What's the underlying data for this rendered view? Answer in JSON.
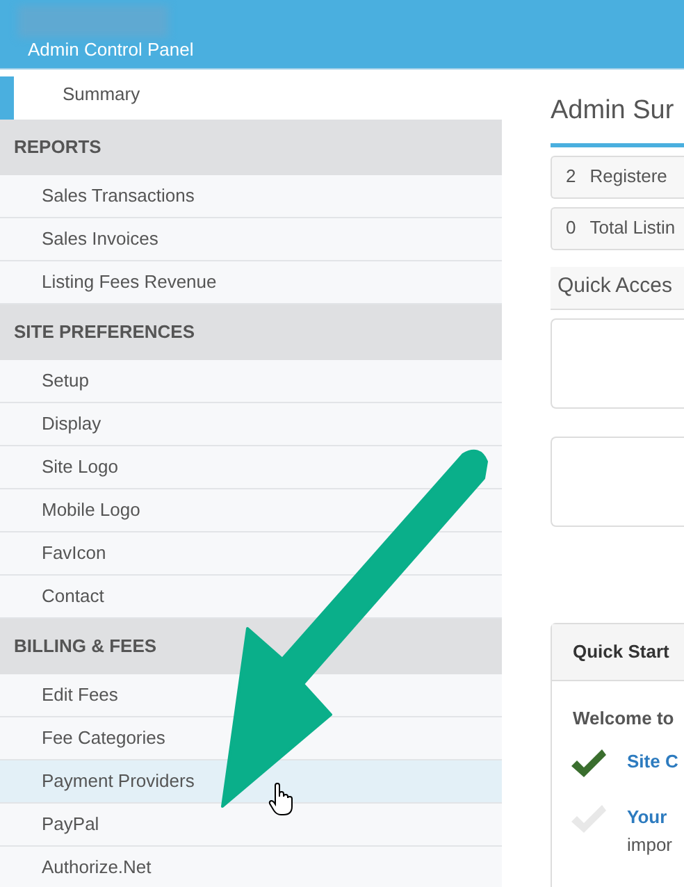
{
  "header": {
    "title": "Admin Control Panel"
  },
  "sidebar": {
    "top_item": {
      "label": "Summary",
      "selected": true
    },
    "sections": [
      {
        "title": "REPORTS",
        "items": [
          {
            "label": "Sales Transactions",
            "highlighted": false
          },
          {
            "label": "Sales Invoices",
            "highlighted": false
          },
          {
            "label": "Listing Fees Revenue",
            "highlighted": false
          }
        ]
      },
      {
        "title": "SITE PREFERENCES",
        "items": [
          {
            "label": "Setup",
            "highlighted": false
          },
          {
            "label": "Display",
            "highlighted": false
          },
          {
            "label": "Site Logo",
            "highlighted": false
          },
          {
            "label": "Mobile Logo",
            "highlighted": false
          },
          {
            "label": "FavIcon",
            "highlighted": false
          },
          {
            "label": "Contact",
            "highlighted": false
          }
        ]
      },
      {
        "title": "BILLING & FEES",
        "items": [
          {
            "label": "Edit Fees",
            "highlighted": false
          },
          {
            "label": "Fee Categories",
            "highlighted": false
          },
          {
            "label": "Payment Providers",
            "highlighted": true
          },
          {
            "label": "PayPal",
            "highlighted": false
          },
          {
            "label": "Authorize.Net",
            "highlighted": false
          }
        ]
      }
    ]
  },
  "main": {
    "title": "Admin Sur",
    "stats": [
      {
        "count": "2",
        "label": "Registere"
      },
      {
        "count": "0",
        "label": "Total Listin"
      }
    ],
    "quick_access": {
      "title": "Quick Acces"
    },
    "quick_start": {
      "title": "Quick Start",
      "welcome": "Welcome to",
      "steps": [
        {
          "done": true,
          "title": "Site C"
        },
        {
          "done": false,
          "title": "Your",
          "text": "impor"
        }
      ]
    }
  }
}
